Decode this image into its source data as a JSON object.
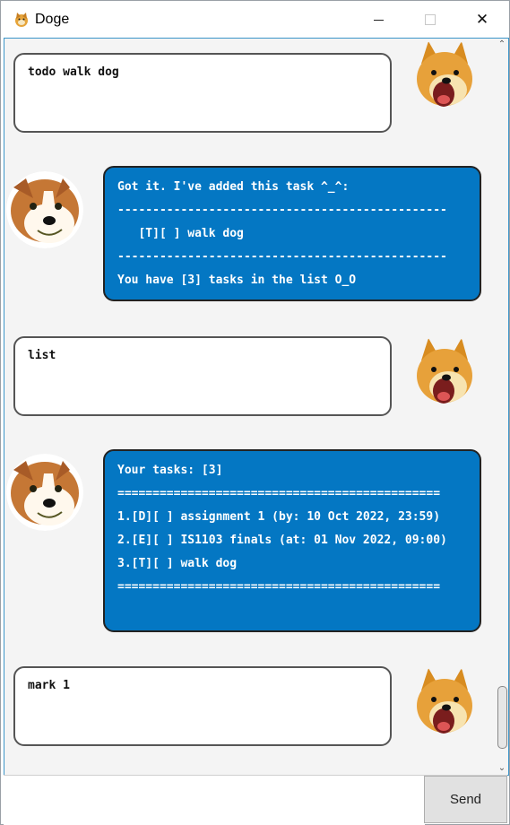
{
  "window": {
    "title": "Doge",
    "icon": "doge-app-icon",
    "controls": {
      "minimize": "minimize-icon",
      "maximize": "maximize-icon",
      "close_glyph": "✕"
    }
  },
  "messages": [
    {
      "sender": "user",
      "avatar": "doge-avatar",
      "lines": [
        "todo walk dog"
      ]
    },
    {
      "sender": "bot",
      "avatar": "corgi-avatar",
      "lines": [
        "Got it. I've added this task ^_^:",
        "-----------------------------------------------",
        "   [T][ ] walk dog",
        "-----------------------------------------------",
        "You have [3] tasks in the list O_O"
      ]
    },
    {
      "sender": "user",
      "avatar": "doge-avatar",
      "lines": [
        "list"
      ]
    },
    {
      "sender": "bot",
      "avatar": "corgi-avatar",
      "lines": [
        "Your tasks: [3]",
        "==============================================",
        "1.[D][ ] assignment 1 (by: 10 Oct 2022, 23:59)",
        "2.[E][ ] IS1103 finals (at: 01 Nov 2022, 09:00)",
        "3.[T][ ] walk dog",
        "=============================================="
      ]
    },
    {
      "sender": "user",
      "avatar": "doge-avatar",
      "lines": [
        "mark 1"
      ]
    }
  ],
  "input": {
    "value": "",
    "placeholder": ""
  },
  "send_button": {
    "label": "Send"
  },
  "colors": {
    "bot_bubble": "#0477c3",
    "user_bubble": "#ffffff",
    "frame_border": "#3c95c9"
  }
}
